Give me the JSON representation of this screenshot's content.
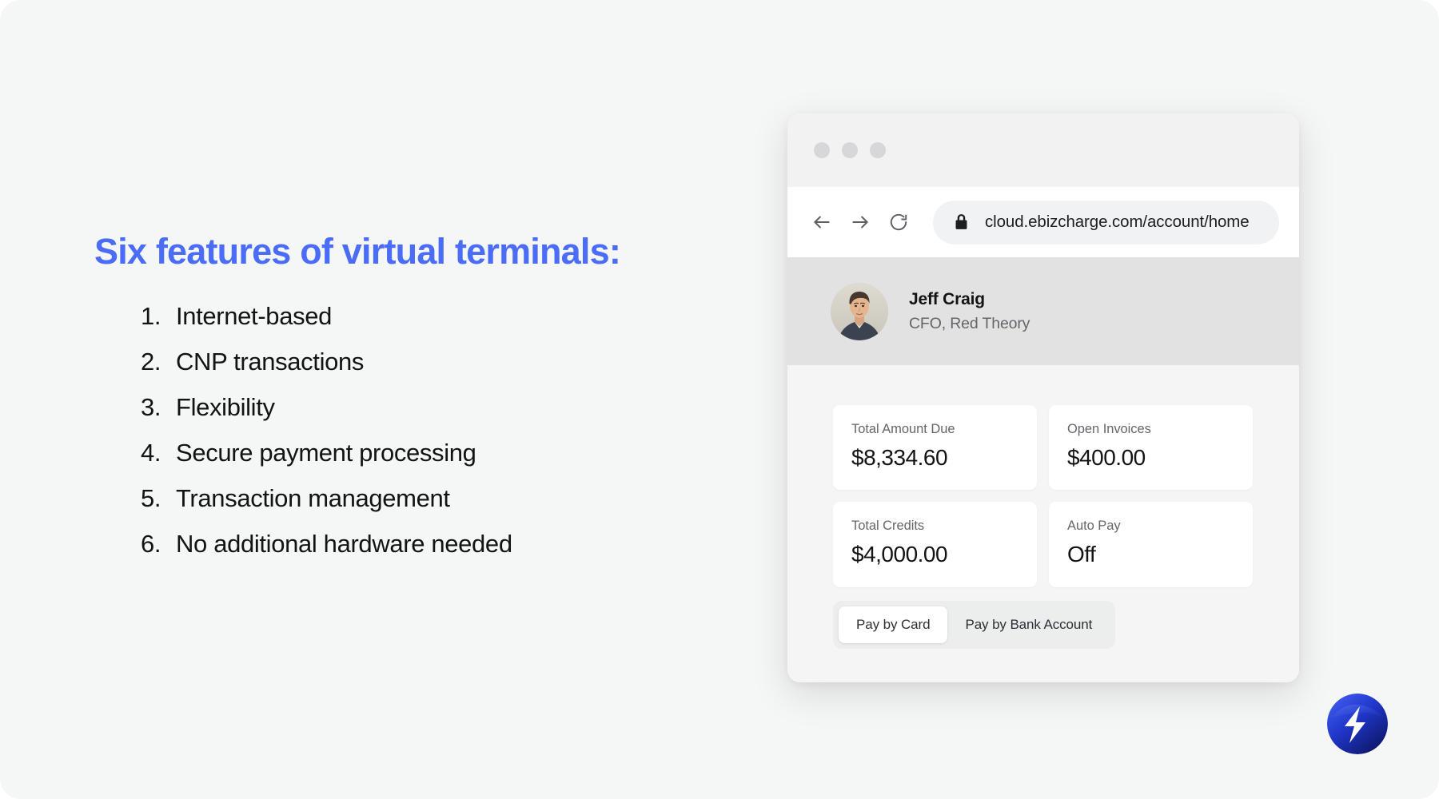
{
  "headline": "Six features of virtual terminals:",
  "features": [
    {
      "num": "1.",
      "text": "Internet-based"
    },
    {
      "num": "2.",
      "text": "CNP transactions"
    },
    {
      "num": "3.",
      "text": "Flexibility"
    },
    {
      "num": "4.",
      "text": "Secure payment processing"
    },
    {
      "num": "5.",
      "text": "Transaction management"
    },
    {
      "num": "6.",
      "text": "No additional hardware needed"
    }
  ],
  "browser": {
    "url": "cloud.ebizcharge.com/account/home",
    "icons": {
      "back": "back-arrow-icon",
      "forward": "forward-arrow-icon",
      "reload": "reload-icon",
      "lock": "lock-icon"
    }
  },
  "account": {
    "name": "Jeff Craig",
    "role": "CFO, Red Theory",
    "stats": [
      {
        "label": "Total Amount Due",
        "value": "$8,334.60"
      },
      {
        "label": "Open Invoices",
        "value": "$400.00"
      },
      {
        "label": "Total Credits",
        "value": "$4,000.00"
      },
      {
        "label": "Auto Pay",
        "value": "Off"
      }
    ],
    "payment_options": [
      {
        "label": "Pay by Card",
        "selected": true
      },
      {
        "label": "Pay by Bank Account",
        "selected": false
      }
    ]
  },
  "colors": {
    "headline": "#4a6cf7",
    "background": "#f5f6f6",
    "card": "#ffffff",
    "profile_band": "#e2e2e3",
    "logo_start": "#2b3fd6",
    "logo_end": "#0f1b6b"
  }
}
